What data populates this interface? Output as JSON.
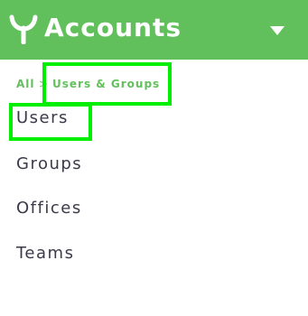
{
  "header": {
    "title": "Accounts",
    "logo_icon": "sprout-icon",
    "dropdown_icon": "caret-down-icon",
    "background_color": "#62c05c"
  },
  "breadcrumb": {
    "all_label": "All",
    "separator": ">",
    "current_label": "Users & Groups"
  },
  "nav": {
    "items": [
      {
        "label": "Users",
        "selected": true
      },
      {
        "label": "Groups"
      },
      {
        "label": "Offices"
      },
      {
        "label": "Teams"
      }
    ]
  },
  "colors": {
    "accent": "#62c05c",
    "highlight": "#00ee00",
    "text": "#3a3a4a"
  }
}
